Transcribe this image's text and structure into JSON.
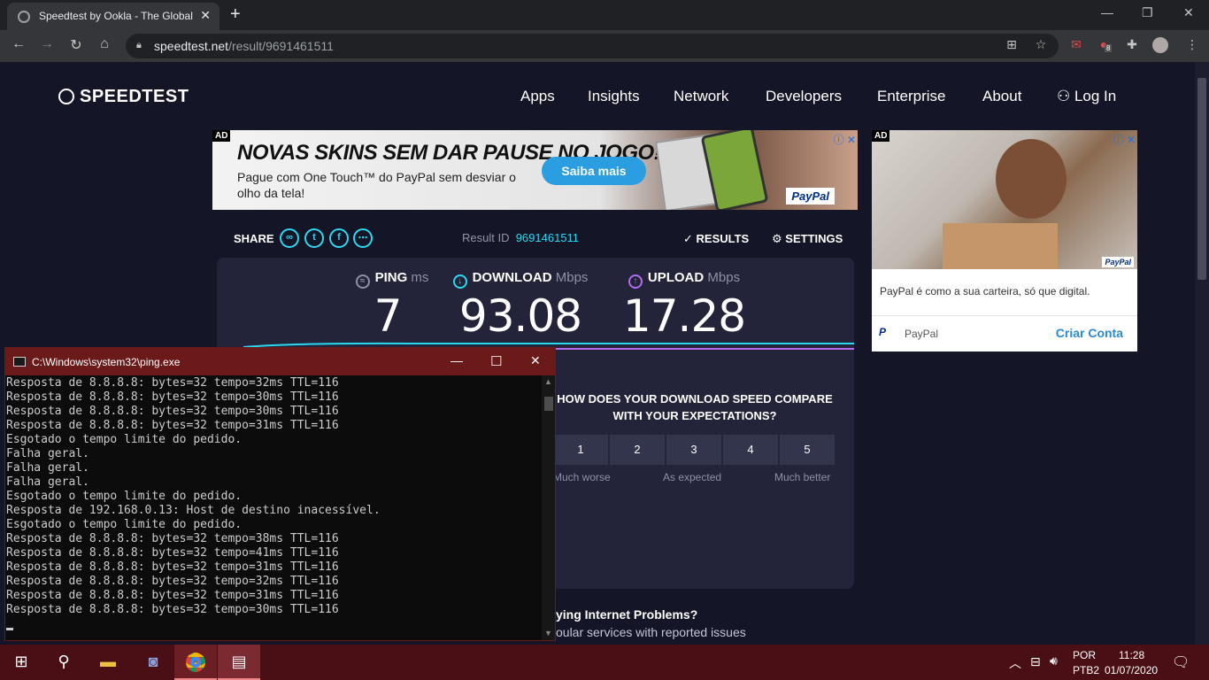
{
  "browser": {
    "tab_title": "Speedtest by Ookla - The Global",
    "tab_close": "✕",
    "new_tab": "+",
    "url_host": "speedtest.net",
    "url_path": "/result/9691461511",
    "minimize": "—",
    "restore": "❐",
    "close": "✕",
    "badge_count": "8"
  },
  "site": {
    "logo": "SPEEDTEST",
    "nav": [
      "Apps",
      "Insights",
      "Network",
      "Developers",
      "Enterprise",
      "About"
    ],
    "login": "Log In"
  },
  "ad_banner": {
    "tag": "AD",
    "headline": "NOVAS SKINS SEM DAR PAUSE NO JOGO!",
    "sub": "Pague com One Touch™ do PayPal sem desviar o olho da tela!",
    "button": "Saiba mais",
    "brand": "PayPal"
  },
  "ad_side": {
    "tag": "AD",
    "text": "PayPal é como a sua carteira, só que digital.",
    "advertiser": "PayPal",
    "cta": "Criar Conta",
    "photo_brand": "PayPal"
  },
  "result": {
    "share_label": "SHARE",
    "result_label": "Result ID",
    "result_id": "9691461511",
    "results_label": "RESULTS",
    "settings_label": "SETTINGS",
    "ping_label": "PING",
    "ping_unit": "ms",
    "ping_value": "7",
    "download_label": "DOWNLOAD",
    "download_unit": "Mbps",
    "download_value": "93.08",
    "upload_label": "UPLOAD",
    "upload_unit": "Mbps",
    "upload_value": "17.28"
  },
  "survey": {
    "question": "HOW DOES YOUR DOWNLOAD SPEED COMPARE WITH YOUR EXPECTATIONS?",
    "options": [
      "1",
      "2",
      "3",
      "4",
      "5"
    ],
    "low": "Much worse",
    "mid": "As expected",
    "high": "Much better"
  },
  "problems": {
    "title": "ying Internet Problems?",
    "sub": "oular services with reported issues"
  },
  "cmd": {
    "title": "C:\\Windows\\system32\\ping.exe",
    "lines": [
      "Resposta de 8.8.8.8: bytes=32 tempo=32ms TTL=116",
      "Resposta de 8.8.8.8: bytes=32 tempo=30ms TTL=116",
      "Resposta de 8.8.8.8: bytes=32 tempo=30ms TTL=116",
      "Resposta de 8.8.8.8: bytes=32 tempo=31ms TTL=116",
      "Esgotado o tempo limite do pedido.",
      "Falha geral.",
      "Falha geral.",
      "Falha geral.",
      "Esgotado o tempo limite do pedido.",
      "Resposta de 192.168.0.13: Host de destino inacessível.",
      "Esgotado o tempo limite do pedido.",
      "Resposta de 8.8.8.8: bytes=32 tempo=38ms TTL=116",
      "Resposta de 8.8.8.8: bytes=32 tempo=41ms TTL=116",
      "Resposta de 8.8.8.8: bytes=32 tempo=31ms TTL=116",
      "Resposta de 8.8.8.8: bytes=32 tempo=32ms TTL=116",
      "Resposta de 8.8.8.8: bytes=32 tempo=31ms TTL=116",
      "Resposta de 8.8.8.8: bytes=32 tempo=30ms TTL=116"
    ]
  },
  "taskbar": {
    "lang1": "POR",
    "lang2": "PTB2",
    "time": "11:28",
    "date": "01/07/2020"
  }
}
